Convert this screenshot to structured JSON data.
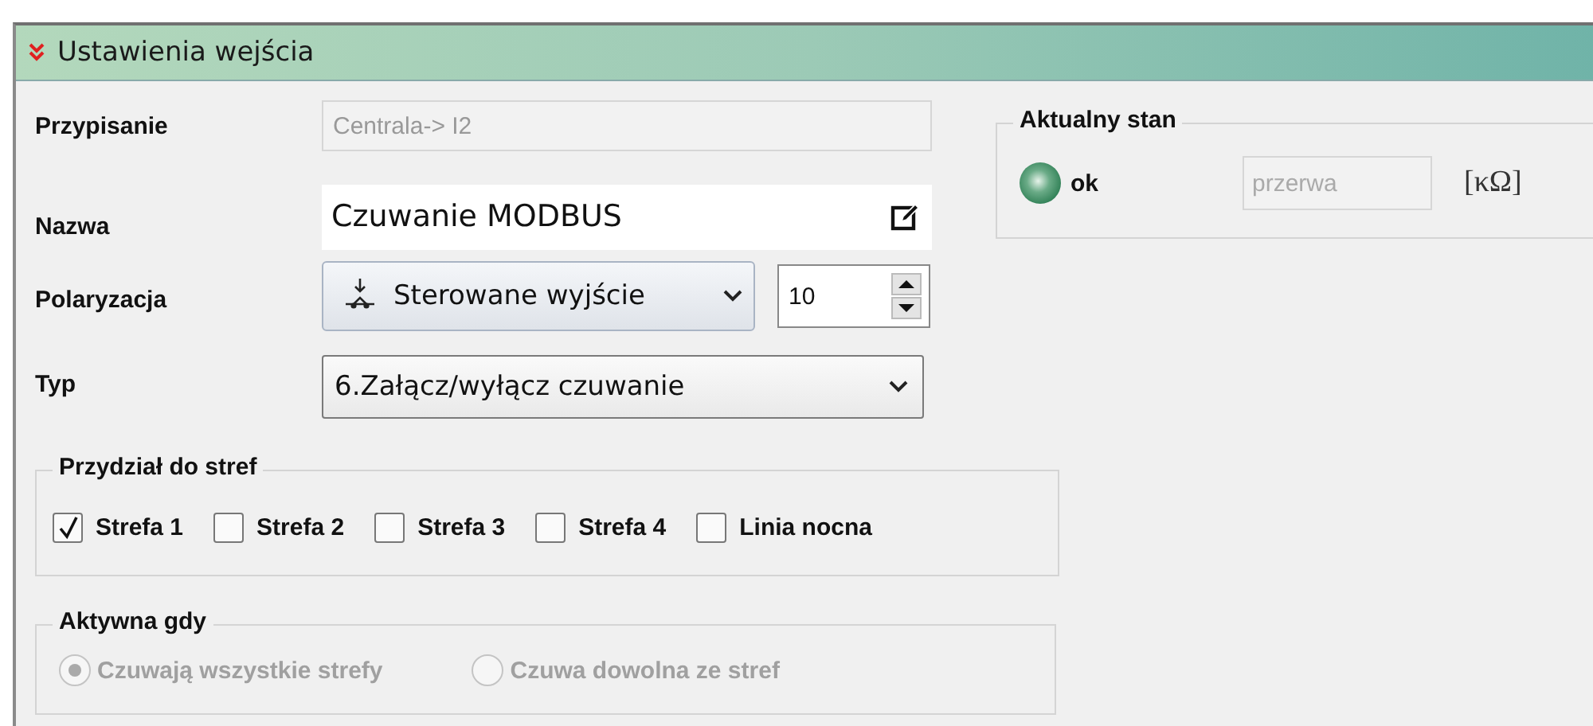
{
  "panel": {
    "title": "Ustawienia wejścia",
    "expanded": true
  },
  "fields": [
    {
      "kind": "readonly",
      "label": "Przypisanie",
      "value": "Centrala-> I2"
    },
    {
      "kind": "edit",
      "label": "Nazwa",
      "value": "Czuwanie MODBUS"
    },
    {
      "kind": "polarization",
      "label": "Polaryzacja",
      "value": "Sterowane wyjście",
      "number": "10"
    },
    {
      "kind": "select",
      "label": "Typ",
      "value": "6.Załącz/wyłącz czuwanie"
    }
  ],
  "status": {
    "title": "Aktualny stan",
    "state": "ok",
    "reading": "przerwa",
    "unit": "[κΩ]"
  },
  "zones": {
    "title": "Przydział do stref",
    "items": [
      {
        "label": "Strefa 1",
        "checked": true
      },
      {
        "label": "Strefa 2",
        "checked": false
      },
      {
        "label": "Strefa 3",
        "checked": false
      },
      {
        "label": "Strefa 4",
        "checked": false
      },
      {
        "label": "Linia nocna",
        "checked": false
      }
    ]
  },
  "active_when": {
    "title": "Aktywna gdy",
    "disabled": true,
    "options": [
      {
        "label": "Czuwają wszystkie strefy",
        "selected": true
      },
      {
        "label": "Czuwa dowolna ze stref",
        "selected": false
      }
    ]
  }
}
